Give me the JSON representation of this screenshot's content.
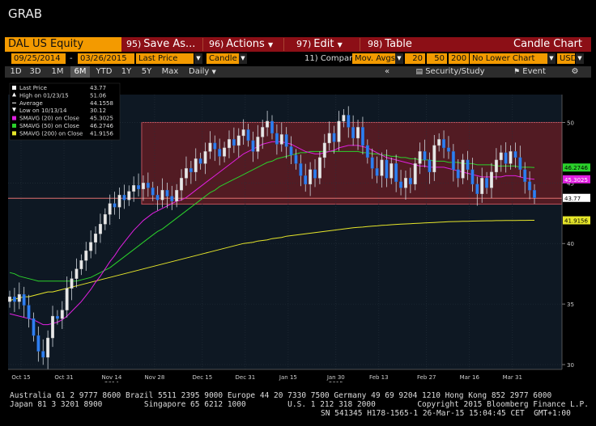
{
  "window_title": "GRAB",
  "toolbar": {
    "ticker": "DAL US Equity",
    "menus": [
      {
        "num": "95)",
        "label": "Save As..."
      },
      {
        "num": "96)",
        "label": "Actions"
      },
      {
        "num": "97)",
        "label": "Edit"
      },
      {
        "num": "98)",
        "label": "Table"
      }
    ],
    "chart_label": "Candle Chart"
  },
  "params": {
    "start_date": "09/25/2014",
    "end_date": "03/26/2015",
    "price_field": "Last Price",
    "chart_style": "Candle",
    "compare_label": "Compare",
    "compare_num": "11)",
    "compare_value": "Mov. Avgs",
    "ma1": "20",
    "ma2": "50",
    "ma3": "200",
    "lower_chart": "No Lower Chart",
    "currency": "USD"
  },
  "ranges": [
    "1D",
    "3D",
    "1M",
    "6M",
    "YTD",
    "1Y",
    "5Y",
    "Max"
  ],
  "active_range": "6M",
  "frequency": "Daily",
  "right_controls": {
    "collapse": "«",
    "security_study": "Security/Study",
    "event": "Event"
  },
  "colors": {
    "accent_orange": "#f39a00",
    "bar_red": "#8c0f16",
    "candle_blue": "#2f7ff0",
    "candle_white": "#e8e8e8",
    "sma20": "#e020e0",
    "sma50": "#2bd12b",
    "sma200": "#e6e62a",
    "band_fill": "#6a1c24"
  },
  "chart_data": {
    "type": "candlestick",
    "title": "",
    "x_tick_labels": [
      "Oct 15",
      "Oct 31",
      "Nov 14",
      "Nov 28",
      "Dec 15",
      "Dec 31",
      "Jan 15",
      "Jan 30",
      "Feb 13",
      "Feb 27",
      "Mar 16",
      "Mar 31"
    ],
    "year_labels": [
      {
        "label": "2014",
        "under": "Nov 14"
      },
      {
        "label": "2015",
        "under": "Jan 30"
      }
    ],
    "y_ticks": [
      30,
      35,
      40,
      45,
      50
    ],
    "ylim": [
      29.6,
      52.3
    ],
    "legend": [
      {
        "label": "Last Price",
        "value": "43.77"
      },
      {
        "label": "High on 01/23/15",
        "value": "51.06"
      },
      {
        "label": "Average",
        "value": "44.1558"
      },
      {
        "label": "Low on 10/13/14",
        "value": "30.12"
      },
      {
        "label": "SMAVG (20) on Close",
        "value": "45.3025"
      },
      {
        "label": "SMAVG (50) on Close",
        "value": "46.2746"
      },
      {
        "label": "SMAVG (200) on Close",
        "value": "41.9156"
      }
    ],
    "right_labels": [
      {
        "value": "46.2746",
        "series": "sma50"
      },
      {
        "value": "45.3025",
        "series": "sma20"
      },
      {
        "value": "43.77",
        "series": "last"
      },
      {
        "value": "41.9156",
        "series": "sma200"
      }
    ],
    "band": {
      "from": "Nov 28",
      "to": "end",
      "high": 50.0,
      "low": 43.25
    },
    "last_price_line": 43.77,
    "closes": [
      35.6,
      35.2,
      35.8,
      34.9,
      33.8,
      32.4,
      31.1,
      30.6,
      32.2,
      34.0,
      33.8,
      34.5,
      36.3,
      37.1,
      37.9,
      38.6,
      39.4,
      40.1,
      40.8,
      41.6,
      42.4,
      43.3,
      43.0,
      44.0,
      43.6,
      44.3,
      44.8,
      44.5,
      45.0,
      44.6,
      44.0,
      43.6,
      44.4,
      43.9,
      43.5,
      44.4,
      45.4,
      46.2,
      45.9,
      47.0,
      46.6,
      47.6,
      48.3,
      47.8,
      47.2,
      47.9,
      48.6,
      48.1,
      48.9,
      49.4,
      48.5,
      47.6,
      48.8,
      49.6,
      50.1,
      49.1,
      48.2,
      49.0,
      48.0,
      47.3,
      46.6,
      45.6,
      44.9,
      46.1,
      45.4,
      47.1,
      48.3,
      49.1,
      48.4,
      50.1,
      50.6,
      49.6,
      48.7,
      49.6,
      48.1,
      47.1,
      46.2,
      45.6,
      46.9,
      45.4,
      46.6,
      45.1,
      44.6,
      45.4,
      44.9,
      46.6,
      47.6,
      46.9,
      45.9,
      48.1,
      48.6,
      47.9,
      47.6,
      46.1,
      45.4,
      46.9,
      46.1,
      44.9,
      44.1,
      45.4,
      44.6,
      45.9,
      46.9,
      47.5,
      46.6,
      47.6,
      47.1,
      46.1,
      45.1,
      44.4,
      43.77
    ],
    "sma20": [
      34.2,
      34.1,
      34.0,
      33.9,
      33.8,
      33.7,
      33.5,
      33.3,
      33.3,
      33.4,
      33.5,
      33.7,
      34.0,
      34.4,
      34.8,
      35.2,
      35.7,
      36.2,
      36.8,
      37.3,
      37.9,
      38.5,
      39.0,
      39.6,
      40.1,
      40.6,
      41.1,
      41.5,
      41.9,
      42.2,
      42.5,
      42.7,
      42.9,
      43.1,
      43.3,
      43.5,
      43.6,
      43.8,
      44.1,
      44.4,
      44.7,
      45.0,
      45.3,
      45.6,
      45.9,
      46.2,
      46.5,
      46.8,
      47.1,
      47.4,
      47.6,
      47.8,
      48.0,
      48.2,
      48.3,
      48.4,
      48.4,
      48.4,
      48.3,
      48.2,
      48.0,
      47.8,
      47.6,
      47.5,
      47.4,
      47.4,
      47.5,
      47.6,
      47.7,
      47.9,
      48.0,
      48.1,
      48.1,
      48.1,
      48.0,
      47.9,
      47.7,
      47.5,
      47.3,
      47.1,
      47.0,
      46.9,
      46.8,
      46.7,
      46.6,
      46.5,
      46.4,
      46.4,
      46.3,
      46.3,
      46.3,
      46.3,
      46.2,
      46.1,
      46.0,
      45.9,
      45.8,
      45.7,
      45.6,
      45.5,
      45.5,
      45.5,
      45.5,
      45.5,
      45.6,
      45.6,
      45.6,
      45.5,
      45.4,
      45.35,
      45.3
    ],
    "sma50": [
      37.6,
      37.5,
      37.3,
      37.2,
      37.1,
      37.0,
      36.9,
      36.9,
      36.9,
      36.9,
      36.9,
      36.9,
      36.9,
      36.9,
      36.9,
      37.0,
      37.1,
      37.2,
      37.4,
      37.6,
      37.8,
      38.0,
      38.3,
      38.6,
      38.9,
      39.2,
      39.5,
      39.8,
      40.1,
      40.4,
      40.7,
      41.0,
      41.2,
      41.5,
      41.8,
      42.1,
      42.4,
      42.7,
      43.0,
      43.3,
      43.6,
      43.9,
      44.2,
      44.4,
      44.7,
      44.9,
      45.1,
      45.3,
      45.5,
      45.7,
      45.9,
      46.1,
      46.3,
      46.5,
      46.7,
      46.8,
      47.0,
      47.1,
      47.2,
      47.3,
      47.4,
      47.5,
      47.5,
      47.6,
      47.6,
      47.6,
      47.6,
      47.6,
      47.6,
      47.6,
      47.6,
      47.6,
      47.6,
      47.6,
      47.5,
      47.5,
      47.4,
      47.4,
      47.3,
      47.3,
      47.2,
      47.2,
      47.1,
      47.1,
      47.0,
      47.0,
      46.9,
      46.9,
      46.9,
      46.8,
      46.8,
      46.8,
      46.7,
      46.7,
      46.7,
      46.6,
      46.6,
      46.6,
      46.5,
      46.5,
      46.5,
      46.5,
      46.4,
      46.4,
      46.4,
      46.4,
      46.4,
      46.3,
      46.3,
      46.3,
      46.27
    ],
    "sma200": [
      35.3,
      35.4,
      35.5,
      35.6,
      35.6,
      35.7,
      35.8,
      35.9,
      36.0,
      36.0,
      36.1,
      36.2,
      36.3,
      36.4,
      36.5,
      36.6,
      36.7,
      36.8,
      36.9,
      37.0,
      37.1,
      37.2,
      37.3,
      37.4,
      37.5,
      37.6,
      37.7,
      37.8,
      37.9,
      38.0,
      38.1,
      38.2,
      38.3,
      38.4,
      38.5,
      38.6,
      38.7,
      38.8,
      38.9,
      39.0,
      39.1,
      39.2,
      39.3,
      39.4,
      39.5,
      39.6,
      39.7,
      39.8,
      39.9,
      40.0,
      40.05,
      40.1,
      40.2,
      40.25,
      40.3,
      40.4,
      40.45,
      40.5,
      40.6,
      40.65,
      40.7,
      40.75,
      40.8,
      40.85,
      40.9,
      40.95,
      41.0,
      41.05,
      41.1,
      41.15,
      41.2,
      41.25,
      41.3,
      41.33,
      41.36,
      41.4,
      41.43,
      41.46,
      41.5,
      41.52,
      41.55,
      41.58,
      41.6,
      41.62,
      41.64,
      41.66,
      41.68,
      41.7,
      41.72,
      41.74,
      41.76,
      41.78,
      41.8,
      41.81,
      41.82,
      41.83,
      41.84,
      41.85,
      41.86,
      41.87,
      41.88,
      41.88,
      41.89,
      41.89,
      41.9,
      41.9,
      41.9,
      41.91,
      41.91,
      41.915,
      41.9156
    ]
  },
  "footer": {
    "line1": "Australia 61 2 9777 8600 Brazil 5511 2395 9000 Europe 44 20 7330 7500 Germany 49 69 9204 1210 Hong Kong 852 2977 6000",
    "line2": "Japan 81 3 3201 8900         Singapore 65 6212 1000         U.S. 1 212 318 2000         Copyright 2015 Bloomberg Finance L.P.",
    "line3": "SN 541345 H178-1565-1 26-Mar-15 15:04:45 CET  GMT+1:00"
  }
}
